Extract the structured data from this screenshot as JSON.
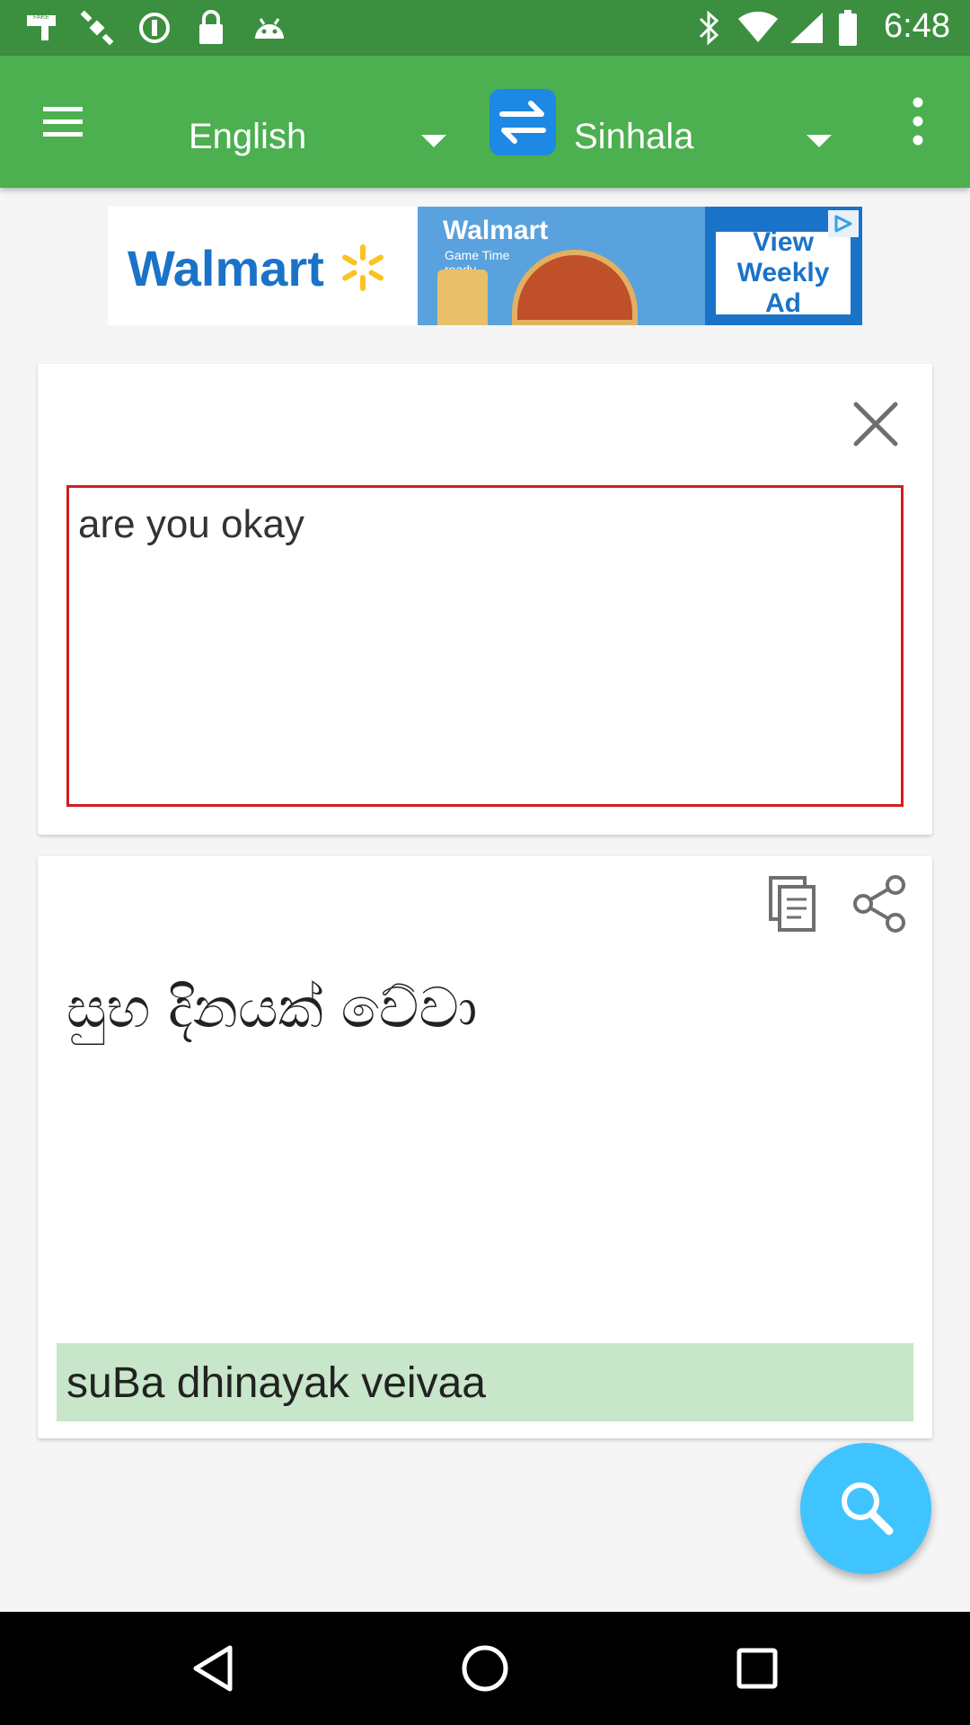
{
  "colors": {
    "status_bar": "#3b8f3f",
    "app_bar": "#4caf50",
    "input_border": "#d01f1f",
    "transliteration_bg": "#c8e6c9",
    "fab": "#40c4ff",
    "swap_button": "#1e88e5",
    "ad_blue": "#1a73c8"
  },
  "status_bar": {
    "time": "6:48",
    "left_icons": [
      "fake-gps-icon",
      "satellite-icon",
      "data-saver-icon",
      "lock-icon",
      "android-icon"
    ],
    "right_icons": [
      "bluetooth-icon",
      "wifi-icon",
      "signal-icon",
      "battery-icon"
    ]
  },
  "app_bar": {
    "menu_icon": "hamburger-menu-icon",
    "source_language": "English",
    "target_language": "Sinhala",
    "swap_icon": "swap-arrows-icon",
    "overflow_icon": "more-vert-icon"
  },
  "ad": {
    "brand": "Walmart",
    "middle_brand": "Walmart",
    "middle_subtitle": "Game Time ready",
    "cta": "View Weekly Ad",
    "badge_icon": "ad-choices-icon"
  },
  "input": {
    "text": "are you okay",
    "clear_icon": "close-icon"
  },
  "output": {
    "translation": "සුභ දිනයක් වේවා",
    "transliteration": "suBa  dhinayak  veivaa",
    "copy_icon": "copy-icon",
    "share_icon": "share-icon"
  },
  "fab": {
    "icon": "search-icon"
  },
  "nav_bar": {
    "icons": [
      "back-icon",
      "home-icon",
      "recents-icon"
    ]
  }
}
